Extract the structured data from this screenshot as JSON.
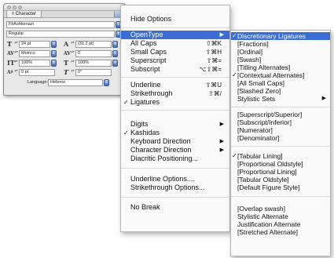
{
  "panel": {
    "tab_label": "◊ Character",
    "font_family": "FbAshkenazi",
    "font_style": "Regular",
    "font_size": "24 pt",
    "leading": "(31.2 pt)",
    "kerning": "Metrics",
    "tracking": "0",
    "vertical_scale": "100%",
    "horizontal_scale": "100%",
    "baseline_shift": "0 pt",
    "skew": "0°",
    "language_label": "Language:",
    "language_value": "Hebrew"
  },
  "menu": {
    "hide_options": "Hide Options",
    "opentype": "OpenType",
    "all_caps": "All Caps",
    "all_caps_sc": "⇧⌘K",
    "small_caps": "Small Caps",
    "small_caps_sc": "⇧⌘H",
    "superscript": "Superscript",
    "superscript_sc": "⇧⌘=",
    "subscript": "Subscript",
    "subscript_sc": "⌥⇧⌘=",
    "underline": "Underline",
    "underline_sc": "⇧⌘U",
    "strikethrough": "Strikethrough",
    "strikethrough_sc": "⇧⌘/",
    "ligatures": "Ligatures",
    "digits": "Digits",
    "kashidas": "Kashidas",
    "keyboard_direction": "Keyboard Direction",
    "character_direction": "Character Direction",
    "diacritic_positioning": "Diacritic Positioning...",
    "underline_options": "Underline Options....",
    "strikethrough_options": "Strikethrough Options...",
    "no_break": "No Break"
  },
  "submenu": {
    "discretionary_ligatures": "Discretionary Ligatures",
    "fractions": "[Fractions]",
    "ordinal": "[Ordinal]",
    "swash": "[Swash]",
    "titling_alternates": "[Titling Alternates]",
    "contextual_alternates": "[Contextual Alternates]",
    "all_small_caps": "[All Small Caps]",
    "slashed_zero": "[Slashed Zero]",
    "stylistic_sets": "Stylistic Sets",
    "superscript_superior": "[Superscript/Superior]",
    "subscript_inferior": "[Subscript/Inferior]",
    "numerator": "[Numerator]",
    "denominator": "[Denominator]",
    "tabular_lining": "[Tabular Lining]",
    "proportional_oldstyle": "[Proportional Oldstyle]",
    "proportional_lining": "[Proportional Lining]",
    "tabular_oldstyle": "[Tabular Oldstyle]",
    "default_figure_style": "[Default Figure Style]",
    "overlap_swash": "[Overlap swash]",
    "stylistic_alternate": "Stylistic Alternate",
    "justification_alternate": "Justification Alternate",
    "stretched_alternate": "[Stretched Alternate]"
  },
  "icons": {
    "check": "✓",
    "submenu_arrow": "▶",
    "stepper": "⇕",
    "spin": "▴▾"
  },
  "colors": {
    "highlight": "#3a6ed6"
  }
}
